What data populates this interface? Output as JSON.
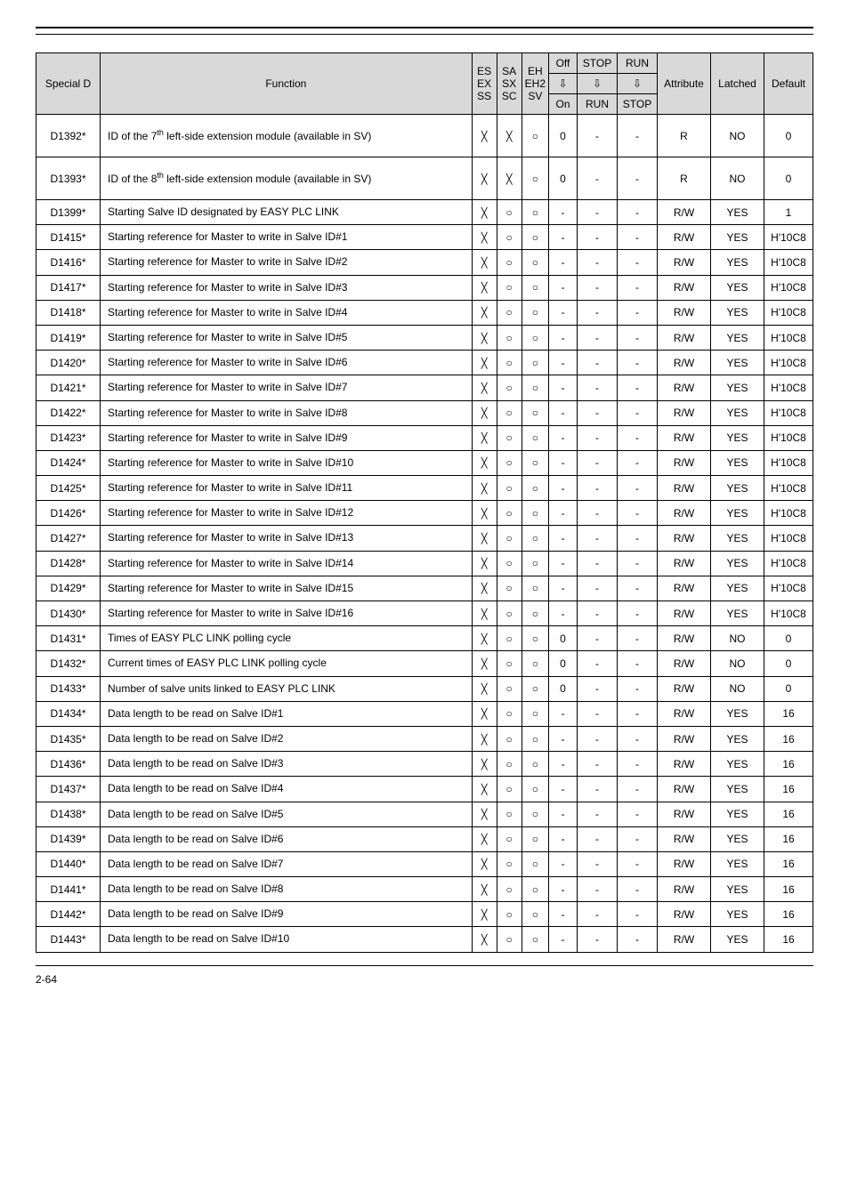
{
  "header": {
    "special": "Special D",
    "function": "Function",
    "c1": "ES\nEX\nSS",
    "c2": "SA\nSX\nSC",
    "c3": "EH\nEH2\nSV",
    "off": "Off",
    "offOn": "On",
    "stop": "STOP",
    "stopRun": "RUN",
    "run": "RUN",
    "runStop": "STOP",
    "attr": "Attribute",
    "latch": "Latched",
    "def": "Default"
  },
  "rows": [
    {
      "id": "D1392*",
      "func": "ID of the 7<sup>th</sup> left-side extension module (available in SV)",
      "c1": "cross",
      "c2": "cross",
      "c3": "circle",
      "off": "0",
      "stop": "-",
      "run": "-",
      "attr": "R",
      "latch": "NO",
      "def": "0",
      "tall": true
    },
    {
      "id": "D1393*",
      "func": "ID of the 8<sup>th</sup> left-side extension module (available in SV)",
      "c1": "cross",
      "c2": "cross",
      "c3": "circle",
      "off": "0",
      "stop": "-",
      "run": "-",
      "attr": "R",
      "latch": "NO",
      "def": "0",
      "tall": true
    },
    {
      "id": "D1399*",
      "func": "Starting Salve ID designated by EASY PLC LINK",
      "c1": "cross",
      "c2": "circle",
      "c3": "circle",
      "off": "-",
      "stop": "-",
      "run": "-",
      "attr": "R/W",
      "latch": "YES",
      "def": "1"
    },
    {
      "id": "D1415*",
      "func": "Starting reference for Master to write in Salve ID#1",
      "c1": "cross",
      "c2": "circle",
      "c3": "circle",
      "off": "-",
      "stop": "-",
      "run": "-",
      "attr": "R/W",
      "latch": "YES",
      "def": "H'10C8"
    },
    {
      "id": "D1416*",
      "func": "Starting reference for Master to write in Salve ID#2",
      "c1": "cross",
      "c2": "circle",
      "c3": "circle",
      "off": "-",
      "stop": "-",
      "run": "-",
      "attr": "R/W",
      "latch": "YES",
      "def": "H'10C8"
    },
    {
      "id": "D1417*",
      "func": "Starting reference for Master to write in Salve ID#3",
      "c1": "cross",
      "c2": "circle",
      "c3": "circle",
      "off": "-",
      "stop": "-",
      "run": "-",
      "attr": "R/W",
      "latch": "YES",
      "def": "H'10C8"
    },
    {
      "id": "D1418*",
      "func": "Starting reference for Master to write in Salve ID#4",
      "c1": "cross",
      "c2": "circle",
      "c3": "circle",
      "off": "-",
      "stop": "-",
      "run": "-",
      "attr": "R/W",
      "latch": "YES",
      "def": "H'10C8"
    },
    {
      "id": "D1419*",
      "func": "Starting reference for Master to write in Salve ID#5",
      "c1": "cross",
      "c2": "circle",
      "c3": "circle",
      "off": "-",
      "stop": "-",
      "run": "-",
      "attr": "R/W",
      "latch": "YES",
      "def": "H'10C8"
    },
    {
      "id": "D1420*",
      "func": "Starting reference for Master to write in Salve ID#6",
      "c1": "cross",
      "c2": "circle",
      "c3": "circle",
      "off": "-",
      "stop": "-",
      "run": "-",
      "attr": "R/W",
      "latch": "YES",
      "def": "H'10C8"
    },
    {
      "id": "D1421*",
      "func": "Starting reference for Master to write in Salve ID#7",
      "c1": "cross",
      "c2": "circle",
      "c3": "circle",
      "off": "-",
      "stop": "-",
      "run": "-",
      "attr": "R/W",
      "latch": "YES",
      "def": "H'10C8"
    },
    {
      "id": "D1422*",
      "func": "Starting reference for Master to write in Salve ID#8",
      "c1": "cross",
      "c2": "circle",
      "c3": "circle",
      "off": "-",
      "stop": "-",
      "run": "-",
      "attr": "R/W",
      "latch": "YES",
      "def": "H'10C8"
    },
    {
      "id": "D1423*",
      "func": "Starting reference for Master to write in Salve ID#9",
      "c1": "cross",
      "c2": "circle",
      "c3": "circle",
      "off": "-",
      "stop": "-",
      "run": "-",
      "attr": "R/W",
      "latch": "YES",
      "def": "H'10C8"
    },
    {
      "id": "D1424*",
      "func": "Starting reference for Master to write in Salve ID#10",
      "c1": "cross",
      "c2": "circle",
      "c3": "circle",
      "off": "-",
      "stop": "-",
      "run": "-",
      "attr": "R/W",
      "latch": "YES",
      "def": "H'10C8"
    },
    {
      "id": "D1425*",
      "func": "Starting reference for Master to write in Salve ID#11",
      "c1": "cross",
      "c2": "circle",
      "c3": "circle",
      "off": "-",
      "stop": "-",
      "run": "-",
      "attr": "R/W",
      "latch": "YES",
      "def": "H'10C8"
    },
    {
      "id": "D1426*",
      "func": "Starting reference for Master to write in Salve ID#12",
      "c1": "cross",
      "c2": "circle",
      "c3": "circle",
      "off": "-",
      "stop": "-",
      "run": "-",
      "attr": "R/W",
      "latch": "YES",
      "def": "H'10C8"
    },
    {
      "id": "D1427*",
      "func": "Starting reference for Master to write in Salve ID#13",
      "c1": "cross",
      "c2": "circle",
      "c3": "circle",
      "off": "-",
      "stop": "-",
      "run": "-",
      "attr": "R/W",
      "latch": "YES",
      "def": "H'10C8"
    },
    {
      "id": "D1428*",
      "func": "Starting reference for Master to write in Salve ID#14",
      "c1": "cross",
      "c2": "circle",
      "c3": "circle",
      "off": "-",
      "stop": "-",
      "run": "-",
      "attr": "R/W",
      "latch": "YES",
      "def": "H'10C8"
    },
    {
      "id": "D1429*",
      "func": "Starting reference for Master to write in Salve ID#15",
      "c1": "cross",
      "c2": "circle",
      "c3": "circle",
      "off": "-",
      "stop": "-",
      "run": "-",
      "attr": "R/W",
      "latch": "YES",
      "def": "H'10C8"
    },
    {
      "id": "D1430*",
      "func": "Starting reference for Master to write in Salve ID#16",
      "c1": "cross",
      "c2": "circle",
      "c3": "circle",
      "off": "-",
      "stop": "-",
      "run": "-",
      "attr": "R/W",
      "latch": "YES",
      "def": "H'10C8"
    },
    {
      "id": "D1431*",
      "func": "Times of EASY PLC LINK polling cycle",
      "c1": "cross",
      "c2": "circle",
      "c3": "circle",
      "off": "0",
      "stop": "-",
      "run": "-",
      "attr": "R/W",
      "latch": "NO",
      "def": "0"
    },
    {
      "id": "D1432*",
      "func": "Current times of EASY PLC LINK polling cycle",
      "c1": "cross",
      "c2": "circle",
      "c3": "circle",
      "off": "0",
      "stop": "-",
      "run": "-",
      "attr": "R/W",
      "latch": "NO",
      "def": "0"
    },
    {
      "id": "D1433*",
      "func": "Number of salve units linked to EASY PLC LINK",
      "c1": "cross",
      "c2": "circle",
      "c3": "circle",
      "off": "0",
      "stop": "-",
      "run": "-",
      "attr": "R/W",
      "latch": "NO",
      "def": "0"
    },
    {
      "id": "D1434*",
      "func": "Data length to be read on Salve ID#1",
      "c1": "cross",
      "c2": "circle",
      "c3": "circle",
      "off": "-",
      "stop": "-",
      "run": "-",
      "attr": "R/W",
      "latch": "YES",
      "def": "16"
    },
    {
      "id": "D1435*",
      "func": "Data length to be read on Salve ID#2",
      "c1": "cross",
      "c2": "circle",
      "c3": "circle",
      "off": "-",
      "stop": "-",
      "run": "-",
      "attr": "R/W",
      "latch": "YES",
      "def": "16"
    },
    {
      "id": "D1436*",
      "func": "Data length to be read on Salve ID#3",
      "c1": "cross",
      "c2": "circle",
      "c3": "circle",
      "off": "-",
      "stop": "-",
      "run": "-",
      "attr": "R/W",
      "latch": "YES",
      "def": "16"
    },
    {
      "id": "D1437*",
      "func": "Data length to be read on Salve ID#4",
      "c1": "cross",
      "c2": "circle",
      "c3": "circle",
      "off": "-",
      "stop": "-",
      "run": "-",
      "attr": "R/W",
      "latch": "YES",
      "def": "16"
    },
    {
      "id": "D1438*",
      "func": "Data length to be read on Salve ID#5",
      "c1": "cross",
      "c2": "circle",
      "c3": "circle",
      "off": "-",
      "stop": "-",
      "run": "-",
      "attr": "R/W",
      "latch": "YES",
      "def": "16"
    },
    {
      "id": "D1439*",
      "func": "Data length to be read on Salve ID#6",
      "c1": "cross",
      "c2": "circle",
      "c3": "circle",
      "off": "-",
      "stop": "-",
      "run": "-",
      "attr": "R/W",
      "latch": "YES",
      "def": "16"
    },
    {
      "id": "D1440*",
      "func": "Data length to be read on Salve ID#7",
      "c1": "cross",
      "c2": "circle",
      "c3": "circle",
      "off": "-",
      "stop": "-",
      "run": "-",
      "attr": "R/W",
      "latch": "YES",
      "def": "16"
    },
    {
      "id": "D1441*",
      "func": "Data length to be read on Salve ID#8",
      "c1": "cross",
      "c2": "circle",
      "c3": "circle",
      "off": "-",
      "stop": "-",
      "run": "-",
      "attr": "R/W",
      "latch": "YES",
      "def": "16"
    },
    {
      "id": "D1442*",
      "func": "Data length to be read on Salve ID#9",
      "c1": "cross",
      "c2": "circle",
      "c3": "circle",
      "off": "-",
      "stop": "-",
      "run": "-",
      "attr": "R/W",
      "latch": "YES",
      "def": "16"
    },
    {
      "id": "D1443*",
      "func": "Data length to be read on Salve ID#10",
      "c1": "cross",
      "c2": "circle",
      "c3": "circle",
      "off": "-",
      "stop": "-",
      "run": "-",
      "attr": "R/W",
      "latch": "YES",
      "def": "16"
    }
  ],
  "footer": {
    "page": "2-64"
  }
}
